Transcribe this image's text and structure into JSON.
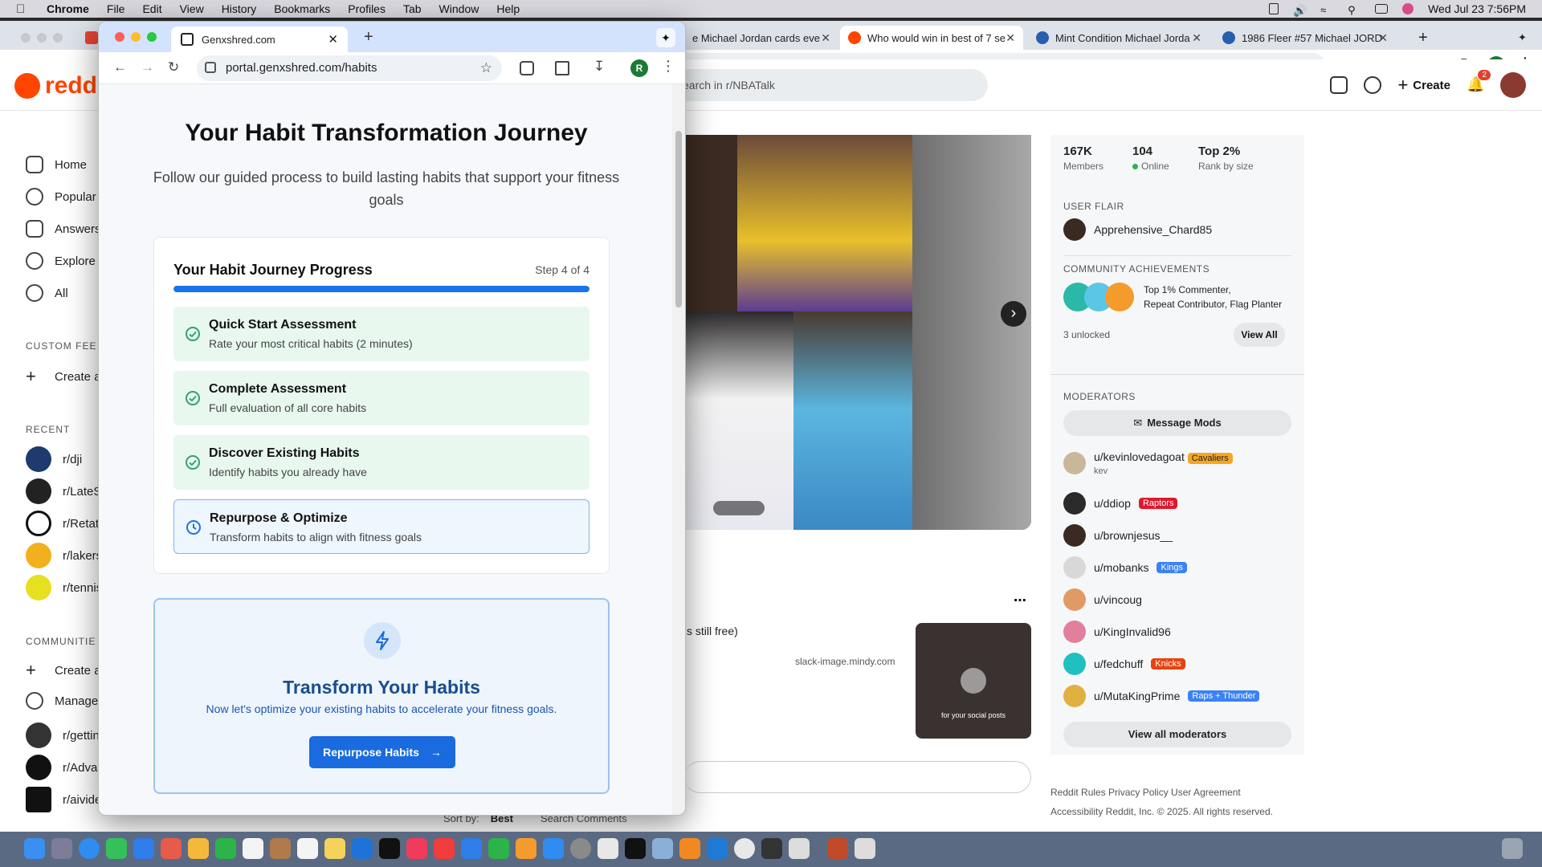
{
  "menubar": {
    "app": "Chrome",
    "items": [
      "File",
      "Edit",
      "View",
      "History",
      "Bookmarks",
      "Profiles",
      "Tab",
      "Window",
      "Help"
    ],
    "clock": "Wed Jul 23  7:56PM"
  },
  "bg_browser": {
    "tabs": [
      {
        "title": "e Michael Jordan cards eve"
      },
      {
        "title": "Who would win in best of 7 se"
      },
      {
        "title": "Mint Condition Michael Jorda"
      },
      {
        "title": "1986 Fleer #57 Michael JORD"
      }
    ]
  },
  "reddit": {
    "logo": "reddi",
    "search_placeholder": "earch in r/NBATalk",
    "create_label": "Create",
    "notif_count": "2",
    "nav": [
      "Home",
      "Popular",
      "Answers",
      "Explore",
      "All"
    ],
    "custom_feeds_head": "CUSTOM FEE",
    "create_feed": "Create a",
    "recent_head": "RECENT",
    "recent": [
      "r/dji",
      "r/LateSt",
      "r/Retatru",
      "r/lakers",
      "r/tennis"
    ],
    "communities_head": "COMMUNITIE",
    "communities": [
      "Create a",
      "Manage",
      "r/getting",
      "r/Advan",
      "r/aivideo"
    ],
    "post2_text": "s still free)",
    "post2_link": "slack-image.mindy.com",
    "thumb_caption": "for your social posts",
    "sort_label": "Sort by:",
    "sort_value": "Best",
    "search_comments": "Search Comments",
    "stats": [
      {
        "value": "167K",
        "label": "Members"
      },
      {
        "value": "104",
        "label": "Online"
      },
      {
        "value": "Top 2%",
        "label": "Rank by size"
      }
    ],
    "user_flair_head": "USER FLAIR",
    "user_flair_name": "Apprehensive_Chard85",
    "achievements_head": "COMMUNITY ACHIEVEMENTS",
    "achievements_text_1": "Top 1% Commenter,",
    "achievements_text_2": "Repeat Contributor, Flag Planter",
    "achievements_unlocked": "3 unlocked",
    "view_all": "View All",
    "moderators_head": "MODERATORS",
    "message_mods": "Message Mods",
    "moderators": [
      {
        "name": "u/kevinlovedagoat",
        "flair": "Cavaliers",
        "flair_color": "#f5a623",
        "sub": "kev"
      },
      {
        "name": "u/ddiop",
        "flair": "Raptors",
        "flair_color": "#e0182d"
      },
      {
        "name": "u/brownjesus__",
        "flair": ""
      },
      {
        "name": "u/mobanks",
        "flair": "Kings",
        "flair_color": "#3b82f6"
      },
      {
        "name": "u/vincoug",
        "flair": ""
      },
      {
        "name": "u/KingInvalid96",
        "flair": ""
      },
      {
        "name": "u/fedchuff",
        "flair": "Knicks",
        "flair_color": "#e8440f"
      },
      {
        "name": "u/MutaKingPrime",
        "flair": "Raps + Thunder",
        "flair_color": "#3b82f6"
      }
    ],
    "view_all_mods": "View all moderators",
    "footer_1": "Reddit Rules   Privacy Policy   User Agreement",
    "footer_2": "Accessibility   Reddit, Inc. © 2025. All rights reserved."
  },
  "fg_browser": {
    "tab_title": "Genxshred.com",
    "url": "portal.genxshred.com/habits",
    "profile_initial": "R"
  },
  "habits": {
    "title": "Your Habit Transformation Journey",
    "subtitle": "Follow our guided process to build lasting habits that support your fitness goals",
    "progress_title": "Your Habit Journey Progress",
    "step_label": "Step 4 of 4",
    "progress_fraction": 1.0,
    "steps": [
      {
        "title": "Quick Start Assessment",
        "desc": "Rate your most critical habits (2 minutes)",
        "status": "done"
      },
      {
        "title": "Complete Assessment",
        "desc": "Full evaluation of all core habits",
        "status": "done"
      },
      {
        "title": "Discover Existing Habits",
        "desc": "Identify habits you already have",
        "status": "done"
      },
      {
        "title": "Repurpose & Optimize",
        "desc": "Transform habits to align with fitness goals",
        "status": "current"
      }
    ],
    "transform_title": "Transform Your Habits",
    "transform_sub": "Now let's optimize your existing habits to accelerate your fitness goals.",
    "cta": "Repurpose Habits"
  },
  "colors": {
    "accent": "#1a73e8",
    "done_bg": "#e8f8ef",
    "check": "#2fa36b",
    "reddit": "#ff4500"
  }
}
